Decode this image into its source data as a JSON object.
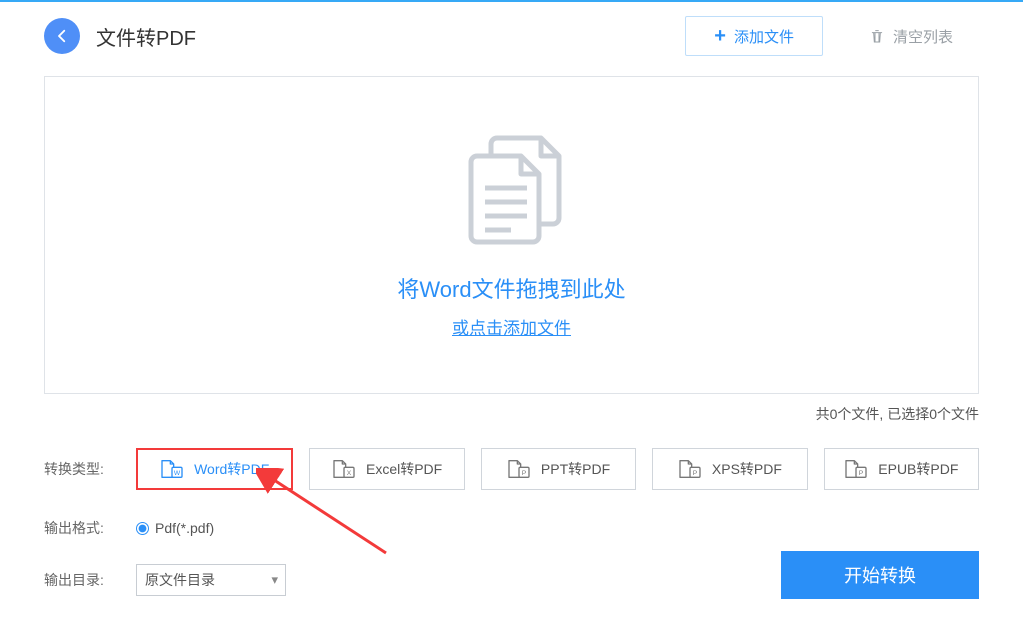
{
  "header": {
    "title": "文件转PDF",
    "add_file_label": "添加文件",
    "clear_list_label": "清空列表"
  },
  "drop": {
    "title": "将Word文件拖拽到此处",
    "link": "或点击添加文件"
  },
  "status": "共0个文件, 已选择0个文件",
  "labels": {
    "convert_type": "转换类型:",
    "output_format": "输出格式:",
    "output_dir": "输出目录:"
  },
  "types": [
    {
      "label": "Word转PDF",
      "letter": "W",
      "active": true
    },
    {
      "label": "Excel转PDF",
      "letter": "X",
      "active": false
    },
    {
      "label": "PPT转PDF",
      "letter": "P",
      "active": false
    },
    {
      "label": "XPS转PDF",
      "letter": "P",
      "active": false
    },
    {
      "label": "EPUB转PDF",
      "letter": "P",
      "active": false
    }
  ],
  "output_format": "Pdf(*.pdf)",
  "output_dir": "原文件目录",
  "start_label": "开始转换"
}
